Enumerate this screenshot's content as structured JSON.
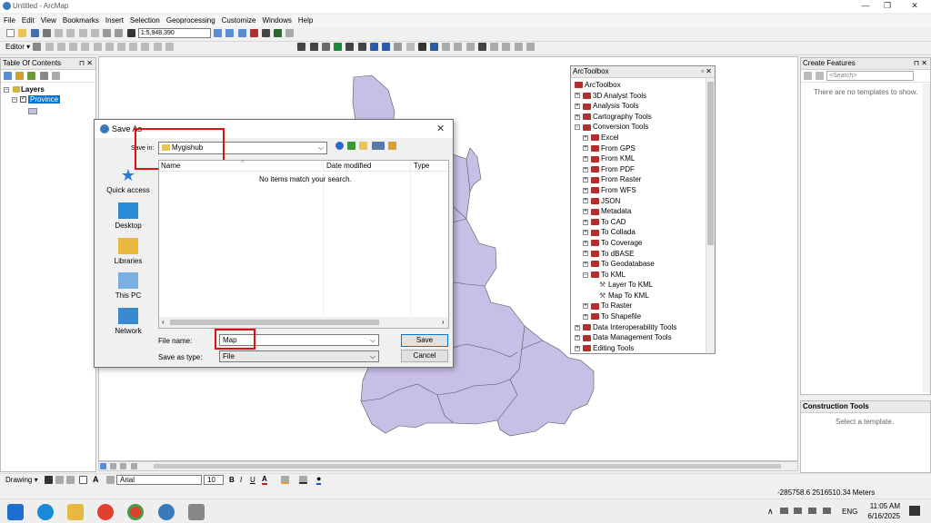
{
  "window": {
    "title": "Untitled - ArcMap",
    "controls": [
      "—",
      "❐",
      "✕"
    ]
  },
  "menu": [
    "File",
    "Edit",
    "View",
    "Bookmarks",
    "Insert",
    "Selection",
    "Geoprocessing",
    "Customize",
    "Windows",
    "Help"
  ],
  "toolbar": {
    "scale": "1:5,948,390",
    "editor_label": "Editor ▾"
  },
  "toc": {
    "title": "Table Of Contents",
    "layers_label": "Layers",
    "layer_name": "Province"
  },
  "toolbox": {
    "title": "ArcToolbox",
    "items": [
      {
        "label": "ArcToolbox",
        "level": 0,
        "kind": "root",
        "toggle": ""
      },
      {
        "label": "3D Analyst Tools",
        "level": 0,
        "kind": "box",
        "toggle": "+"
      },
      {
        "label": "Analysis Tools",
        "level": 0,
        "kind": "box",
        "toggle": "+"
      },
      {
        "label": "Cartography Tools",
        "level": 0,
        "kind": "box",
        "toggle": "+"
      },
      {
        "label": "Conversion Tools",
        "level": 0,
        "kind": "box",
        "toggle": "−"
      },
      {
        "label": "Excel",
        "level": 1,
        "kind": "box",
        "toggle": "+"
      },
      {
        "label": "From GPS",
        "level": 1,
        "kind": "box",
        "toggle": "+"
      },
      {
        "label": "From KML",
        "level": 1,
        "kind": "box",
        "toggle": "+"
      },
      {
        "label": "From PDF",
        "level": 1,
        "kind": "box",
        "toggle": "+"
      },
      {
        "label": "From Raster",
        "level": 1,
        "kind": "box",
        "toggle": "+"
      },
      {
        "label": "From WFS",
        "level": 1,
        "kind": "box",
        "toggle": "+"
      },
      {
        "label": "JSON",
        "level": 1,
        "kind": "box",
        "toggle": "+"
      },
      {
        "label": "Metadata",
        "level": 1,
        "kind": "box",
        "toggle": "+"
      },
      {
        "label": "To CAD",
        "level": 1,
        "kind": "box",
        "toggle": "+"
      },
      {
        "label": "To Collada",
        "level": 1,
        "kind": "box",
        "toggle": "+"
      },
      {
        "label": "To Coverage",
        "level": 1,
        "kind": "box",
        "toggle": "+"
      },
      {
        "label": "To dBASE",
        "level": 1,
        "kind": "box",
        "toggle": "+"
      },
      {
        "label": "To Geodatabase",
        "level": 1,
        "kind": "box",
        "toggle": "+"
      },
      {
        "label": "To KML",
        "level": 1,
        "kind": "box",
        "toggle": "−"
      },
      {
        "label": "Layer To KML",
        "level": 2,
        "kind": "tool",
        "toggle": ""
      },
      {
        "label": "Map To KML",
        "level": 2,
        "kind": "tool",
        "toggle": ""
      },
      {
        "label": "To Raster",
        "level": 1,
        "kind": "box",
        "toggle": "+"
      },
      {
        "label": "To Shapefile",
        "level": 1,
        "kind": "box",
        "toggle": "+"
      },
      {
        "label": "Data Interoperability Tools",
        "level": 0,
        "kind": "box",
        "toggle": "+"
      },
      {
        "label": "Data Management Tools",
        "level": 0,
        "kind": "box",
        "toggle": "+"
      },
      {
        "label": "Editing Tools",
        "level": 0,
        "kind": "box",
        "toggle": "+"
      }
    ]
  },
  "create_features": {
    "title": "Create Features",
    "search_placeholder": "<Search>",
    "empty_text": "There are no templates to show."
  },
  "construction_tools": {
    "title": "Construction Tools",
    "empty_text": "Select a template."
  },
  "dialog": {
    "title": "Save As",
    "save_in_label": "Save in:",
    "save_in_value": "Mygishub",
    "columns": [
      "Name",
      "Date modified",
      "Type"
    ],
    "empty_text": "No items match your search.",
    "places": [
      "Quick access",
      "Desktop",
      "Libraries",
      "This PC",
      "Network"
    ],
    "file_name_label": "File name:",
    "file_name_value": "Map",
    "save_as_type_label": "Save as type:",
    "save_as_type_value": "File",
    "save_button": "Save",
    "cancel_button": "Cancel"
  },
  "drawing_toolbar": {
    "drawing_label": "Drawing ▾",
    "font": "Arial",
    "size": "10",
    "bold": "B",
    "italic": "I",
    "underline": "U"
  },
  "status": {
    "coords": "-285758.6  2516510.34 Meters"
  },
  "taskbar": {
    "time": "11:05 AM",
    "date": "6/16/2025",
    "lang": "ENG"
  },
  "colors": {
    "province_fill": "#c8bfe7",
    "highlight_red": "#e01010",
    "selection_blue": "#0078d7"
  }
}
